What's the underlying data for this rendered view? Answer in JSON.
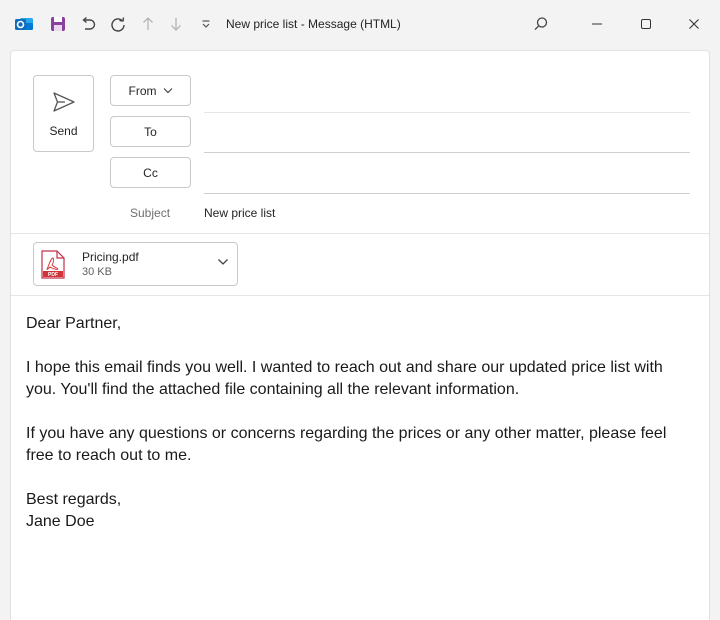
{
  "titlebar": {
    "title": "New price list",
    "separator": "-",
    "format": "Message (HTML)"
  },
  "colors": {
    "outlook_blue": "#0f6cbd",
    "save_purple": "#8b3f9e",
    "pdf_red": "#d13438"
  },
  "compose": {
    "send_label": "Send",
    "from_label": "From",
    "to_label": "To",
    "cc_label": "Cc",
    "subject_label": "Subject",
    "subject_value": "New price list"
  },
  "attachment": {
    "name": "Pricing.pdf",
    "size": "30 KB",
    "icon_text": "PDF"
  },
  "body": {
    "paragraphs": [
      "Dear Partner,",
      "I hope this email finds you well. I wanted to reach out and share our updated price list with you. You'll find the attached file containing all the relevant information.",
      "If you have any questions or concerns regarding the prices or any other matter, please feel free to reach out to me."
    ],
    "signoff": "Best regards,",
    "signature": "Jane Doe"
  }
}
